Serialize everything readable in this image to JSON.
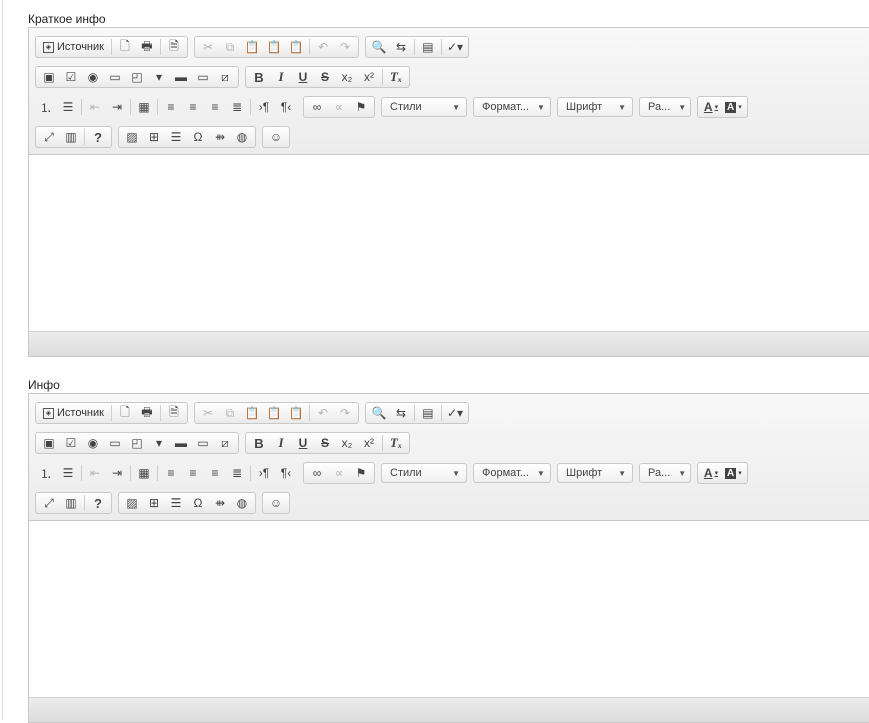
{
  "editors": [
    {
      "label": "Краткое инфо",
      "toolbar": {
        "source_label": "Источник",
        "styles_label": "Стили",
        "format_label": "Формат...",
        "font_label": "Шрифт",
        "size_label": "Ра...",
        "text_color_label": "A",
        "bg_color_label": "A",
        "help_label": "?"
      }
    },
    {
      "label": "Инфо",
      "toolbar": {
        "source_label": "Источник",
        "styles_label": "Стили",
        "format_label": "Формат...",
        "font_label": "Шрифт",
        "size_label": "Ра...",
        "text_color_label": "A",
        "bg_color_label": "A",
        "help_label": "?"
      }
    }
  ],
  "icons": {
    "row1": [
      "source-icon",
      "preview-icon",
      "print-icon",
      "templates-icon",
      "cut-icon",
      "copy-icon",
      "paste-icon",
      "paste-text-icon",
      "paste-word-icon",
      "undo-icon",
      "redo-icon",
      "find-icon",
      "replace-icon",
      "select-all-icon",
      "spellcheck-icon"
    ],
    "row2": [
      "form-icon",
      "checkbox-icon",
      "radio-icon",
      "text-field-icon",
      "textarea-icon",
      "select-icon",
      "button-icon",
      "image-button-icon",
      "hidden-field-icon",
      "bold-icon",
      "italic-icon",
      "underline-icon",
      "strike-icon",
      "subscript-icon",
      "superscript-icon",
      "remove-format-icon"
    ],
    "row3": [
      "numbered-list-icon",
      "bulleted-list-icon",
      "outdent-icon",
      "indent-icon",
      "div-icon",
      "align-left-icon",
      "align-center-icon",
      "align-right-icon",
      "justify-icon",
      "ltr-icon",
      "rtl-icon",
      "link-icon",
      "unlink-icon",
      "anchor-icon"
    ],
    "row4": [
      "maximize-icon",
      "show-blocks-icon",
      "help-icon",
      "image-icon",
      "table-icon",
      "horizontal-rule-icon",
      "special-char-icon",
      "page-break-icon",
      "iframe-icon",
      "smiley-icon"
    ]
  },
  "colors": {
    "toolbar_bg": "#efefef",
    "border": "#c8c8c8",
    "status_bar": "#e2e2e2"
  }
}
